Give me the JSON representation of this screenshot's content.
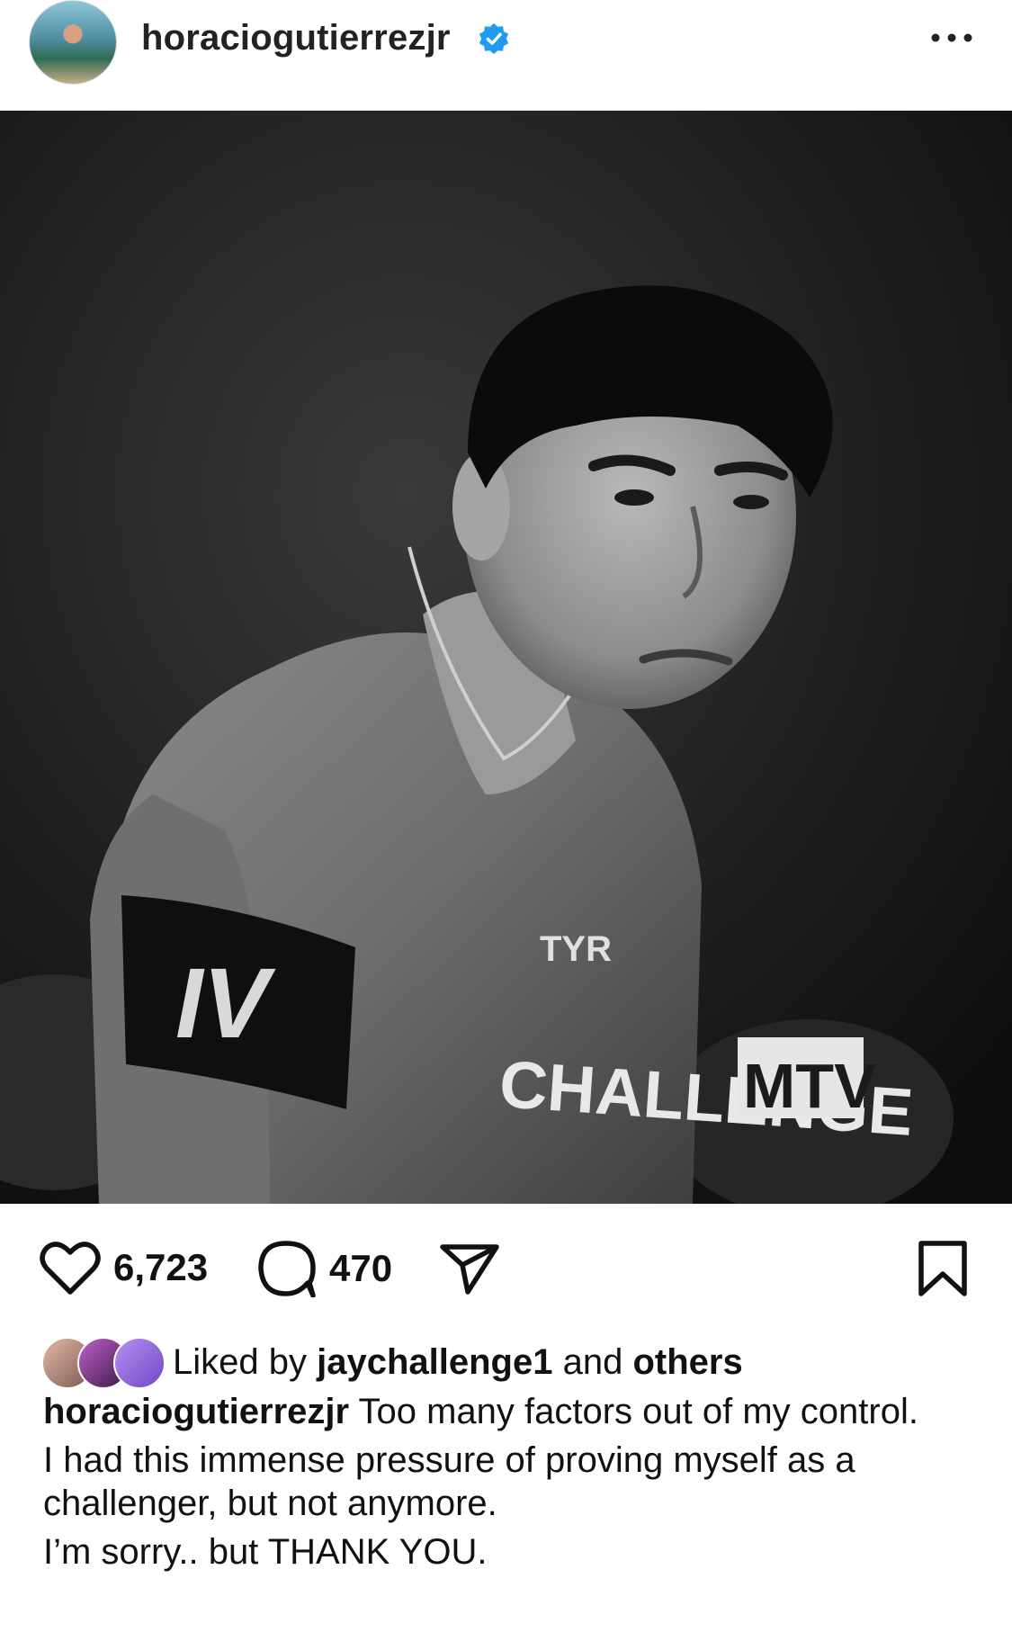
{
  "post": {
    "username": "horaciogutierrezjr",
    "verified_icon": "verified-badge-icon",
    "more_icon": "more-horizontal-icon",
    "image": {
      "armband_text": "IV",
      "shirt_text": "CHALLENGE",
      "shirt_logo": "TYR",
      "watermark": "MTV"
    },
    "likes_count": "6,723",
    "comments_count": "470",
    "liked_by_prefix": "Liked by",
    "liked_by_user": "jaychallenge1",
    "liked_by_and": "and",
    "liked_by_others": "others",
    "caption_user": "horaciogutierrezjr",
    "caption_line1": "Too many factors out of my control.",
    "caption_line2": "I had this immense pressure of proving myself as a challenger, but not anymore.",
    "caption_line3": "I’m sorry.. but THANK YOU."
  },
  "colors": {
    "verified": "#1f9cf0",
    "text": "#111111",
    "background": "#ffffff"
  }
}
